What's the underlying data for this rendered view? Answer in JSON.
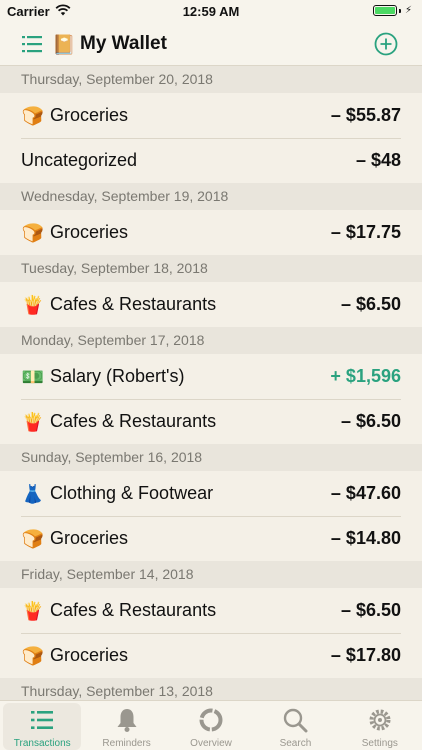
{
  "status_bar": {
    "carrier": "Carrier",
    "time": "12:59 AM"
  },
  "nav": {
    "title": "My Wallet",
    "wallet_emoji": "📔"
  },
  "sections": [
    {
      "date": "Thursday, September 20, 2018",
      "rows": [
        {
          "emoji": "🍞",
          "category": "Groceries",
          "amount": "– $55.87",
          "type": "expense"
        },
        {
          "emoji": "",
          "category": "Uncategorized",
          "amount": "– $48",
          "type": "expense"
        }
      ]
    },
    {
      "date": "Wednesday, September 19, 2018",
      "rows": [
        {
          "emoji": "🍞",
          "category": "Groceries",
          "amount": "– $17.75",
          "type": "expense"
        }
      ]
    },
    {
      "date": "Tuesday, September 18, 2018",
      "rows": [
        {
          "emoji": "🍟",
          "category": "Cafes & Restaurants",
          "amount": "– $6.50",
          "type": "expense"
        }
      ]
    },
    {
      "date": "Monday, September 17, 2018",
      "rows": [
        {
          "emoji": "💵",
          "category": "Salary (Robert's)",
          "amount": "+ $1,596",
          "type": "income"
        },
        {
          "emoji": "🍟",
          "category": "Cafes & Restaurants",
          "amount": "– $6.50",
          "type": "expense"
        }
      ]
    },
    {
      "date": "Sunday, September 16, 2018",
      "rows": [
        {
          "emoji": "👗",
          "category": "Clothing & Footwear",
          "amount": "– $47.60",
          "type": "expense"
        },
        {
          "emoji": "🍞",
          "category": "Groceries",
          "amount": "– $14.80",
          "type": "expense"
        }
      ]
    },
    {
      "date": "Friday, September 14, 2018",
      "rows": [
        {
          "emoji": "🍟",
          "category": "Cafes & Restaurants",
          "amount": "– $6.50",
          "type": "expense"
        },
        {
          "emoji": "🍞",
          "category": "Groceries",
          "amount": "– $17.80",
          "type": "expense"
        }
      ]
    },
    {
      "date": "Thursday, September 13, 2018",
      "rows": []
    }
  ],
  "tabs": [
    {
      "label": "Transactions",
      "icon": "list-icon",
      "active": true
    },
    {
      "label": "Reminders",
      "icon": "bell-icon",
      "active": false
    },
    {
      "label": "Overview",
      "icon": "pie-icon",
      "active": false
    },
    {
      "label": "Search",
      "icon": "search-icon",
      "active": false
    },
    {
      "label": "Settings",
      "icon": "gear-icon",
      "active": false
    }
  ],
  "colors": {
    "accent": "#2aa27f",
    "background": "#f4f0e7",
    "header": "#e9e5dc"
  }
}
